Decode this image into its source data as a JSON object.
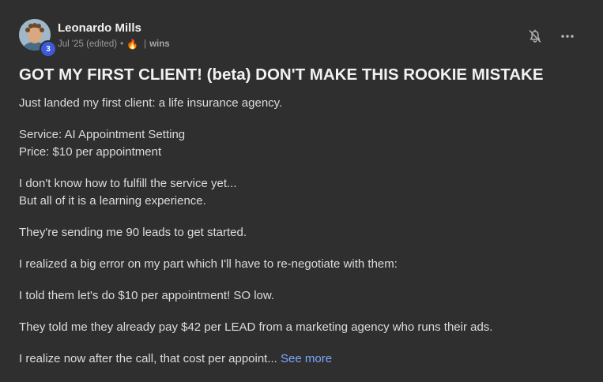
{
  "post": {
    "author": "Leonardo Mills",
    "level": "3",
    "date": "Jul '25 (edited)",
    "dot": "•",
    "fire": "🔥",
    "pipe": "|",
    "category": "wins",
    "title": "GOT MY FIRST CLIENT! (beta) DON'T MAKE THIS ROOKIE MISTAKE",
    "paragraphs": [
      {
        "lines": [
          "Just landed my first client: a life insurance agency."
        ]
      },
      {
        "lines": [
          "Service: AI Appointment Setting",
          "Price: $10 per appointment"
        ]
      },
      {
        "lines": [
          "I don't know how to fulfill the service yet...",
          "But all of it is a learning experience."
        ]
      },
      {
        "lines": [
          "They're sending me 90 leads to get started."
        ]
      },
      {
        "lines": [
          "I realized a big error on my part which I'll have to re-negotiate with them:"
        ]
      },
      {
        "lines": [
          "I told them let's do $10 per appointment! SO low."
        ]
      },
      {
        "lines": [
          "They told me they already pay $42 per LEAD from a marketing agency who runs their ads."
        ]
      }
    ],
    "last_line": "I realize now after the call, that cost per appoint...",
    "see_more": "See more"
  },
  "icons": {
    "bell": "bell-off-icon",
    "more": "more-horizontal-icon"
  },
  "colors": {
    "background": "#2f2f2f",
    "link": "#7ea6ff",
    "badge": "#3b5bdb"
  }
}
